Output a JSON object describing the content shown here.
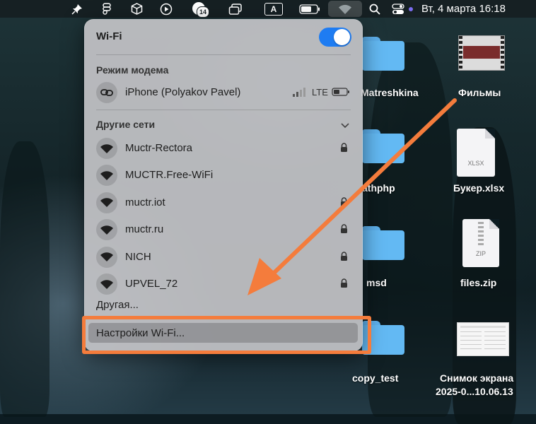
{
  "menubar": {
    "datetime": "Вт, 4 марта  16:18",
    "calendar_badge": "14",
    "input_source": "A",
    "icons": [
      "pin-icon",
      "figma-icon",
      "box-icon",
      "play-icon",
      "calendar-icon",
      "windows-icon",
      "input-source-icon",
      "battery-icon",
      "wifi-icon",
      "search-icon",
      "control-center-icon",
      "siri-dot-icon"
    ]
  },
  "wifi_panel": {
    "title": "Wi-Fi",
    "wifi_enabled": true,
    "hotspot_header": "Режим модема",
    "hotspot": {
      "name": "iPhone (Polyakov Pavel)",
      "network_type": "LTE",
      "icon": "link-icon"
    },
    "other_networks_header": "Другие сети",
    "networks": [
      {
        "name": "Muctr-Rectora",
        "locked": true
      },
      {
        "name": "MUCTR.Free-WiFi",
        "locked": false
      },
      {
        "name": "muctr.iot",
        "locked": true
      },
      {
        "name": "muctr.ru",
        "locked": true
      },
      {
        "name": "NICH",
        "locked": true
      },
      {
        "name": "UPVEL_72",
        "locked": true
      }
    ],
    "other_label": "Другая...",
    "settings_label": "Настройки Wi-Fi..."
  },
  "desktop": {
    "folders": [
      {
        "label": "Matreshkina"
      },
      {
        "label": "athphp"
      },
      {
        "label": "msd"
      },
      {
        "label": "copy_test"
      }
    ],
    "files": [
      {
        "label": "Фильмы"
      },
      {
        "label": "Букер.xlsx",
        "ext": "XLSX"
      },
      {
        "label": "files.zip",
        "ext": "ZIP"
      },
      {
        "label": "Снимок экрана",
        "label2": "2025-0...10.06.13"
      }
    ]
  },
  "annotation": {
    "arrow_color": "#f47c3c",
    "highlight_color": "#f47c3c"
  }
}
